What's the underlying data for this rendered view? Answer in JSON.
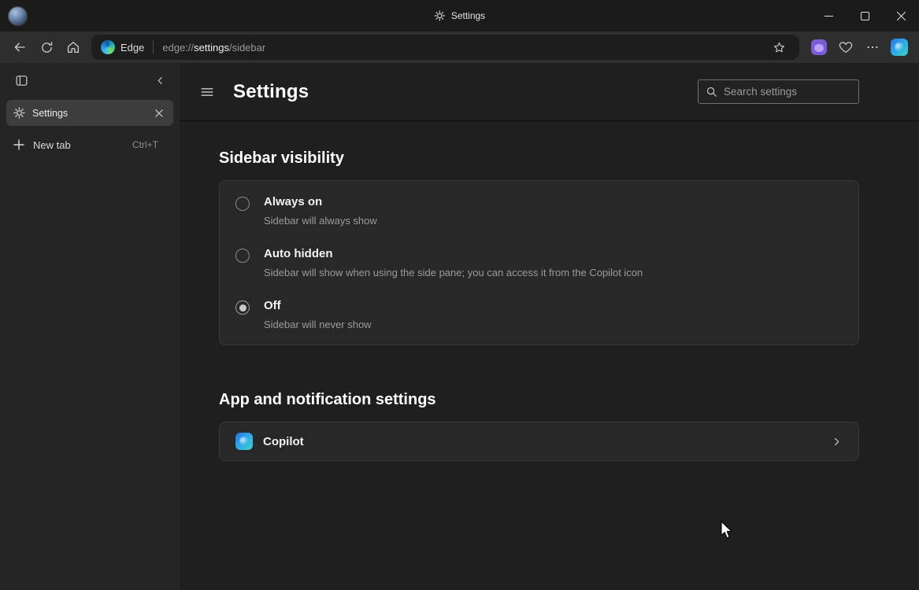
{
  "titlebar": {
    "title": "Settings"
  },
  "toolbar": {
    "address": {
      "site": "Edge",
      "scheme": "edge://",
      "section": "settings",
      "path": "/sidebar"
    }
  },
  "tab_sidebar": {
    "active_tab": {
      "label": "Settings"
    },
    "new_tab": {
      "label": "New tab",
      "shortcut": "Ctrl+T"
    }
  },
  "settings": {
    "title": "Settings",
    "search_placeholder": "Search settings",
    "sidebar_visibility": {
      "heading": "Sidebar visibility",
      "options": [
        {
          "label": "Always on",
          "description": "Sidebar will always show",
          "selected": false
        },
        {
          "label": "Auto hidden",
          "description": "Sidebar will show when using the side pane; you can access it from the Copilot icon",
          "selected": false
        },
        {
          "label": "Off",
          "description": "Sidebar will never show",
          "selected": true
        }
      ]
    },
    "app_notifications": {
      "heading": "App and notification settings",
      "rows": [
        {
          "label": "Copilot"
        }
      ]
    }
  },
  "icons": {
    "profile-avatar": "user-photo",
    "settings-gear": "gear",
    "back": "arrow-left",
    "refresh": "circular-arrow",
    "home": "house",
    "favorite": "star-outline",
    "extension": "purple-extension",
    "browser-essentials": "heart-pulse",
    "more-menu": "ellipsis",
    "copilot": "copilot-gradient",
    "search": "magnifier",
    "hamburger": "three-lines"
  },
  "colors": {
    "window_bg": "#1f1f1f",
    "titlebar_bg": "#1b1b1b",
    "toolbar_bg": "#2e2e2e",
    "card_bg": "#282828",
    "copilot_gradient_start": "#2f6fe4",
    "copilot_gradient_end": "#3fd3c9"
  }
}
